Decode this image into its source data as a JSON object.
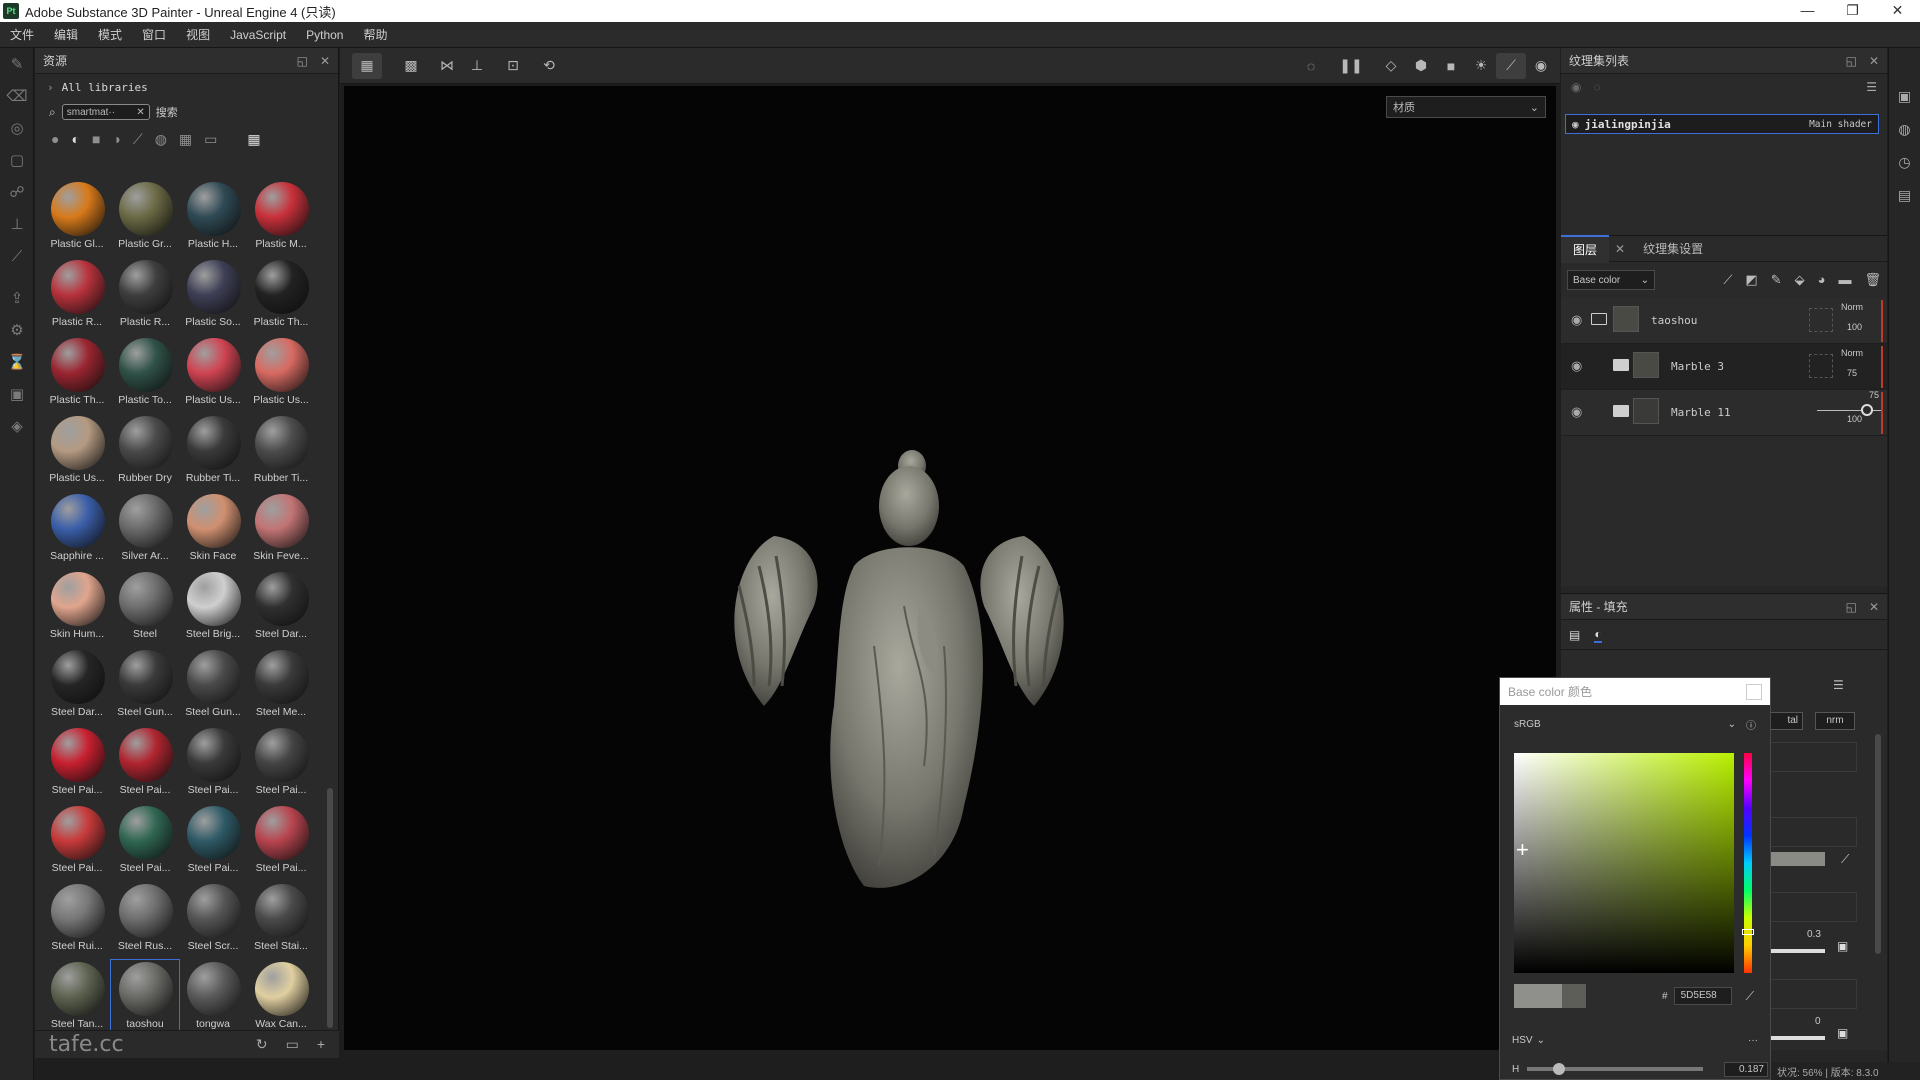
{
  "window": {
    "logo": "Pt",
    "title": "Adobe Substance 3D Painter - Unreal Engine 4 (只读)",
    "buttons": [
      "—",
      "❐",
      "✕"
    ]
  },
  "menu": [
    "文件",
    "编辑",
    "模式",
    "窗口",
    "视图",
    "JavaScript",
    "Python",
    "帮助"
  ],
  "assets": {
    "title": "资源",
    "libraries": "All libraries",
    "search_value": "smartmat··",
    "search_label": "搜索",
    "materials": [
      "Plastic Gl...",
      "Plastic Gr...",
      "Plastic H...",
      "Plastic M...",
      "Plastic R...",
      "Plastic R...",
      "Plastic So...",
      "Plastic Th...",
      "Plastic Th...",
      "Plastic To...",
      "Plastic Us...",
      "Plastic Us...",
      "Plastic Us...",
      "Rubber Dry",
      "Rubber Ti...",
      "Rubber Ti...",
      "Sapphire ...",
      "Silver Ar...",
      "Skin Face",
      "Skin Feve...",
      "Skin Hum...",
      "Steel",
      "Steel Brig...",
      "Steel Dar...",
      "Steel Dar...",
      "Steel Gun...",
      "Steel Gun...",
      "Steel Me...",
      "Steel Pai...",
      "Steel Pai...",
      "Steel Pai...",
      "Steel Pai...",
      "Steel Pai...",
      "Steel Pai...",
      "Steel Pai...",
      "Steel Pai...",
      "Steel Rui...",
      "Steel Rus...",
      "Steel Scr...",
      "Steel Stai...",
      "Steel Tan...",
      "taoshou",
      "tongwa",
      "Wax Can..."
    ],
    "ball_colors": [
      "#d87a1a",
      "#6b6a45",
      "#2f4a55",
      "#c8303a",
      "#b8323c",
      "#3e3e3e",
      "#3e3f55",
      "#222222",
      "#9a2530",
      "#2f5248",
      "#d04452",
      "#d86a62",
      "#b49a82",
      "#4a4a4a",
      "#3a3a3a",
      "#4c4c4c",
      "#3a5ea8",
      "#6a6a6a",
      "#d09070",
      "#c27474",
      "#e0a58e",
      "#6e6e6e",
      "#cfcfcf",
      "#303030",
      "#252525",
      "#3a3a3a",
      "#4a4a4a",
      "#3a3a3a",
      "#c82030",
      "#b02530",
      "#3a3a3a",
      "#444444",
      "#c83a3a",
      "#2f6652",
      "#2e5a66",
      "#b8444e",
      "#777777",
      "#6e6e6e",
      "#555555",
      "#4a4a4a",
      "#5d6350",
      "#6a6a66",
      "#5a5a5a",
      "#e0cfa0"
    ],
    "selected": "taoshou",
    "watermark": "tafe.cc"
  },
  "viewport": {
    "select_value": "材质"
  },
  "texture_sets": {
    "title": "纹理集列表",
    "item_name": "jialingpinjia",
    "item_shader": "Main shader"
  },
  "layers": {
    "tabs": [
      "图层",
      "纹理集设置"
    ],
    "channel": "Base color",
    "rows": [
      {
        "name": "taoshou",
        "blend": "Norm",
        "opacity": "100"
      },
      {
        "name": "Marble 3",
        "blend": "Norm",
        "opacity": "75"
      },
      {
        "name": "Marble 11",
        "blend": "",
        "opacity": "100"
      }
    ],
    "slider_value": "75"
  },
  "properties": {
    "title": "属性 - 填充",
    "tag_a": "tal",
    "tag_b": "nrm",
    "value_a": "0.3",
    "value_b": "0"
  },
  "color_picker": {
    "title": "Base color 颜色",
    "colorspace": "sRGB",
    "hex_label": "#",
    "hex": "5D5E58",
    "mode": "HSV",
    "h_label": "H",
    "h_value": "0.187",
    "more": "···"
  },
  "status": {
    "text": "状况: 56% | 版本: 8.3.0"
  }
}
